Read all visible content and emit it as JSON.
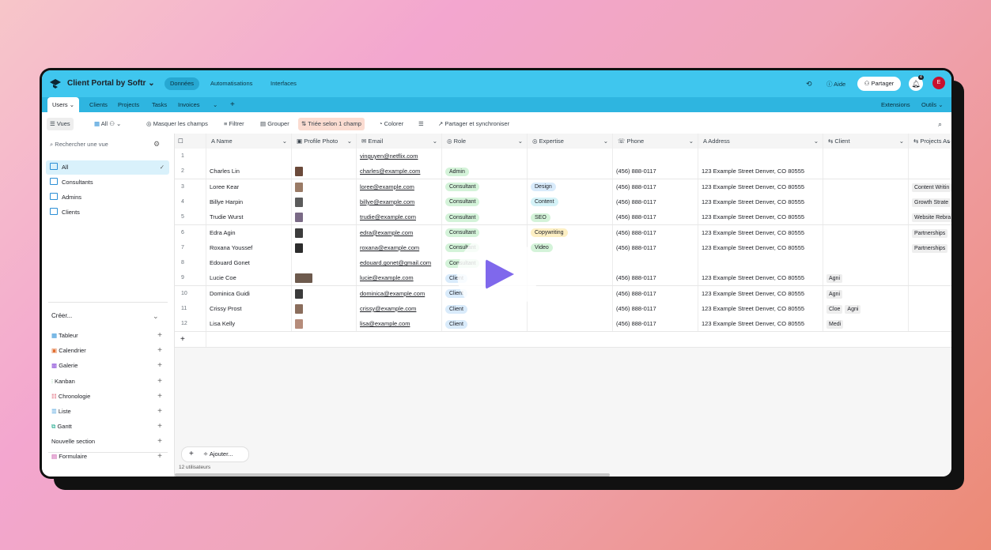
{
  "colors": {
    "topbar": "#3fc6ee",
    "tabbar": "#2eb5e0",
    "accent": "#7f68ec",
    "avatar": "#c8102e"
  },
  "app": {
    "title": "Client Portal by Softr",
    "nav": [
      {
        "label": "Données",
        "active": true
      },
      {
        "label": "Automatisations"
      },
      {
        "label": "Interfaces"
      }
    ],
    "help": "Aide",
    "share": "Partager",
    "notif_count": "4",
    "avatar": "E"
  },
  "tabs": {
    "items": [
      "Users",
      "Clients",
      "Projects",
      "Tasks",
      "Invoices"
    ],
    "extensions": "Extensions",
    "tools": "Outils"
  },
  "toolbar": {
    "views": "Vues",
    "all": "All",
    "hide": "Masquer les champs",
    "filter": "Filtrer",
    "group": "Grouper",
    "sort": "Triée selon 1 champ",
    "color": "Colorer",
    "share": "Partager et synchroniser"
  },
  "sidebar": {
    "search_placeholder": "Rechercher une vue",
    "views": [
      "All",
      "Consultants",
      "Admins",
      "Clients"
    ],
    "create_label": "Créer...",
    "create_items": [
      "Tableur",
      "Calendrier",
      "Galerie",
      "Kanban",
      "Chronologie",
      "Liste",
      "Gantt"
    ],
    "new_section": "Nouvelle section",
    "form": "Formulaire"
  },
  "table": {
    "columns": [
      "Name",
      "Profile Photo",
      "Email",
      "Role",
      "Expertise",
      "Phone",
      "Address",
      "Client",
      "Projects As"
    ],
    "rows": [
      {
        "n": "1",
        "name": "",
        "email": "vinguyen@netflix.com",
        "role": "",
        "exp": "",
        "phone": "",
        "addr": "",
        "client": [],
        "proj": ""
      },
      {
        "n": "2",
        "name": "Charles Lin",
        "email": "charles@example.com",
        "role": "Admin",
        "exp": "",
        "phone": "(456) 888-0117",
        "addr": "123 Example Street Denver, CO 80555",
        "client": [],
        "proj": ""
      },
      {
        "n": "3",
        "name": "Loree Kear",
        "email": "loree@example.com",
        "role": "Consultant",
        "exp": "Design",
        "phone": "(456) 888-0117",
        "addr": "123 Example Street Denver, CO 80555",
        "client": [],
        "proj": "Content Writin"
      },
      {
        "n": "4",
        "name": "Billye Harpin",
        "email": "billye@example.com",
        "role": "Consultant",
        "exp": "Content",
        "phone": "(456) 888-0117",
        "addr": "123 Example Street Denver, CO 80555",
        "client": [],
        "proj": "Growth Strate"
      },
      {
        "n": "5",
        "name": "Trudie Wurst",
        "email": "trudie@example.com",
        "role": "Consultant",
        "exp": "SEO",
        "phone": "(456) 888-0117",
        "addr": "123 Example Street Denver, CO 80555",
        "client": [],
        "proj": "Website Rebra"
      },
      {
        "n": "6",
        "name": "Edra Agin",
        "email": "edra@example.com",
        "role": "Consultant",
        "exp": "Copywriting",
        "phone": "(456) 888-0117",
        "addr": "123 Example Street Denver, CO 80555",
        "client": [],
        "proj": "Partnerships"
      },
      {
        "n": "7",
        "name": "Roxana Youssef",
        "email": "roxana@example.com",
        "role": "Consultant",
        "exp": "Video",
        "phone": "(456) 888-0117",
        "addr": "123 Example Street Denver, CO 80555",
        "client": [],
        "proj": "Partnerships"
      },
      {
        "n": "8",
        "name": "Edouard Gonet",
        "email": "edouard.gonet@gmail.com",
        "role": "Consultant",
        "exp": "",
        "phone": "",
        "addr": "",
        "client": [],
        "proj": ""
      },
      {
        "n": "9",
        "name": "Lucie Coe",
        "email": "lucie@example.com",
        "role": "Client",
        "exp": "",
        "phone": "(456) 888-0117",
        "addr": "123 Example Street Denver, CO 80555",
        "client": [
          "Agni"
        ],
        "proj": ""
      },
      {
        "n": "10",
        "name": "Dominica Guidi",
        "email": "dominica@example.com",
        "role": "Client",
        "exp": "",
        "phone": "(456) 888-0117",
        "addr": "123 Example Street Denver, CO 80555",
        "client": [
          "Agni"
        ],
        "proj": ""
      },
      {
        "n": "11",
        "name": "Crissy Prost",
        "email": "crissy@example.com",
        "role": "Client",
        "exp": "",
        "phone": "(456) 888-0117",
        "addr": "123 Example Street Denver, CO 80555",
        "client": [
          "Cloe",
          "Agni"
        ],
        "proj": ""
      },
      {
        "n": "12",
        "name": "Lisa Kelly",
        "email": "lisa@example.com",
        "role": "Client",
        "exp": "",
        "phone": "(456) 888-0117",
        "addr": "123 Example Street Denver, CO 80555",
        "client": [
          "Medi"
        ],
        "proj": ""
      }
    ],
    "add_label": "Ajouter...",
    "count_label": "12 utilisateurs"
  },
  "pill_colors": {
    "Admin": "#d4f3d9",
    "Consultant": "#d4f3d9",
    "Client": "#d9ebfb",
    "Design": "#d9ebfb",
    "Content": "#d4f2f7",
    "SEO": "#d4f3d9",
    "Copywriting": "#fdefc3",
    "Video": "#d4f3d9"
  }
}
